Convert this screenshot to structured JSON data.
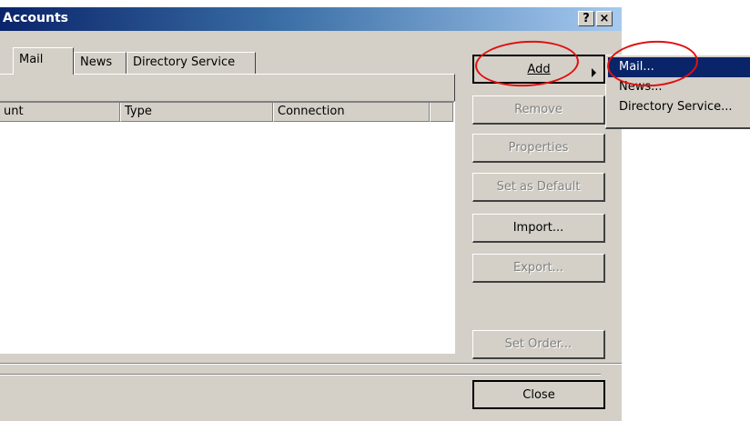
{
  "window": {
    "title": "Accounts",
    "help_glyph": "?",
    "close_glyph": "×"
  },
  "tabs": [
    {
      "label": "Mail"
    },
    {
      "label": "News"
    },
    {
      "label": "Directory Service"
    }
  ],
  "list": {
    "columns": [
      "unt",
      "Type",
      "Connection",
      ""
    ]
  },
  "buttons": {
    "add": "Add",
    "remove": "Remove",
    "properties": "Properties",
    "set_default": "Set as Default",
    "import": "Import...",
    "export": "Export...",
    "set_order": "Set Order...",
    "close": "Close"
  },
  "add_menu": {
    "items": [
      "Mail...",
      "News...",
      "Directory Service..."
    ]
  },
  "colors": {
    "selection": "#0a246a",
    "annotation": "#e01010",
    "face": "#d4d0c8"
  }
}
